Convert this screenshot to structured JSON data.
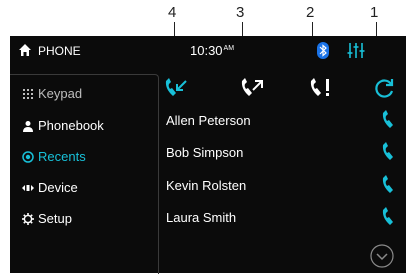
{
  "callouts": [
    "4",
    "3",
    "2",
    "1"
  ],
  "header": {
    "title": "PHONE",
    "time": "10:30",
    "ampm": "AM"
  },
  "sidebar": {
    "items": [
      {
        "label": "Keypad",
        "icon": "keypad-icon"
      },
      {
        "label": "Phonebook",
        "icon": "person-icon"
      },
      {
        "label": "Recents",
        "icon": "recents-icon",
        "active": true
      },
      {
        "label": "Device",
        "icon": "device-icon"
      },
      {
        "label": "Setup",
        "icon": "gear-icon"
      }
    ]
  },
  "tabs": [
    {
      "name": "incoming-calls",
      "icon": "incoming-call-icon"
    },
    {
      "name": "outgoing-calls",
      "icon": "outgoing-call-icon"
    },
    {
      "name": "missed-calls",
      "icon": "missed-call-icon"
    },
    {
      "name": "refresh",
      "icon": "refresh-icon"
    }
  ],
  "contacts": [
    "Allen Peterson",
    "Bob Simpson",
    "Kevin Rolsten",
    "Laura Smith"
  ],
  "colors": {
    "accent": "#18c0d8",
    "background": "#0b0b0b",
    "text": "#ffffff",
    "bluetooth": "#1a73e8"
  }
}
